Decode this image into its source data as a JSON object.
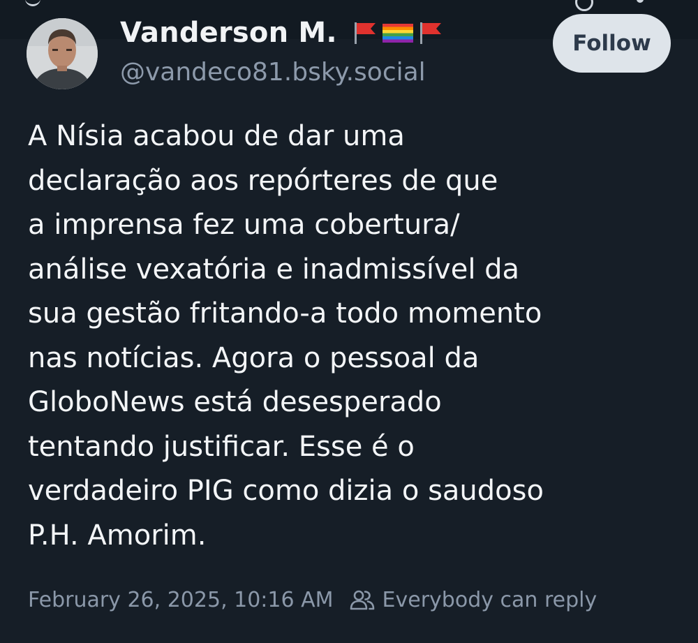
{
  "author": {
    "display_name": "Vanderson M.",
    "handle": "@vandeco81.bsky.social",
    "flag_icons": [
      "red-flag-icon",
      "rainbow-flag-icon",
      "red-flag-icon"
    ]
  },
  "follow_button": {
    "label": "Follow"
  },
  "post": {
    "text": "A Nísia acabou de dar uma\ndeclaração aos repórteres de que\na imprensa fez uma cobertura/\nanálise vexatória e inadmissível da\nsua gestão fritando-a todo momento\nnas notícias. Agora o pessoal da\nGloboNews está desesperado\ntentando justificar. Esse é o\nverdadeiro PIG como dizia o saudoso\nP.H. Amorim.",
    "timestamp": "February 26, 2025, 10:16 AM",
    "reply_setting": "Everybody can reply"
  },
  "colors": {
    "background": "#161e27",
    "text": "#f3f5f7",
    "muted": "#8b98a9",
    "follow_button_bg": "#dee4ea",
    "follow_button_text": "#2d3a4b"
  }
}
